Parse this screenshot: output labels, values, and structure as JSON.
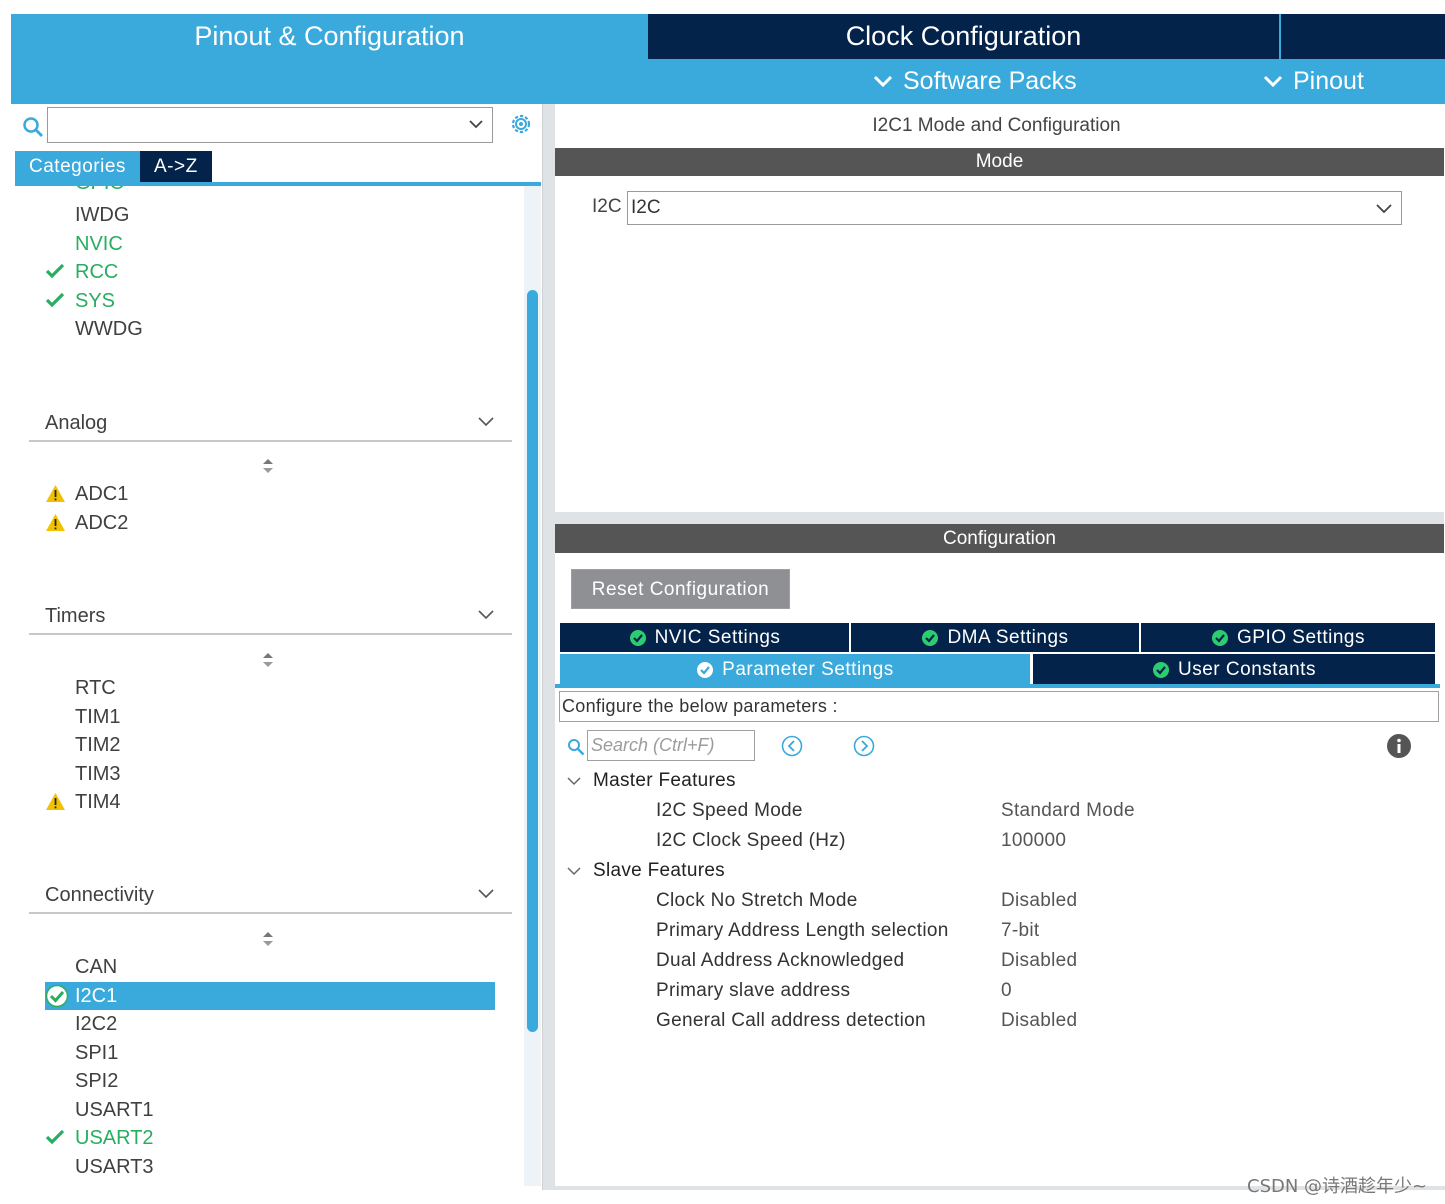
{
  "header": {
    "tab_pinout": "Pinout & Configuration",
    "tab_clock": "Clock Configuration",
    "subtab_software_packs": "Software Packs",
    "subtab_pinout": "Pinout"
  },
  "left": {
    "search_value": "",
    "category_tabs": [
      "Categories",
      "A->Z"
    ],
    "partial_item": "GPIO",
    "system_items": [
      {
        "label": "IWDG",
        "status": "none"
      },
      {
        "label": "NVIC",
        "status": "green"
      },
      {
        "label": "RCC",
        "status": "check"
      },
      {
        "label": "SYS",
        "status": "check"
      },
      {
        "label": "WWDG",
        "status": "none"
      }
    ],
    "groups": {
      "analog": {
        "title": "Analog",
        "items": [
          {
            "label": "ADC1",
            "status": "warning"
          },
          {
            "label": "ADC2",
            "status": "warning"
          }
        ]
      },
      "timers": {
        "title": "Timers",
        "items": [
          {
            "label": "RTC",
            "status": "none"
          },
          {
            "label": "TIM1",
            "status": "none"
          },
          {
            "label": "TIM2",
            "status": "none"
          },
          {
            "label": "TIM3",
            "status": "none"
          },
          {
            "label": "TIM4",
            "status": "warning"
          }
        ]
      },
      "connectivity": {
        "title": "Connectivity",
        "items": [
          {
            "label": "CAN",
            "status": "none"
          },
          {
            "label": "I2C1",
            "status": "selected"
          },
          {
            "label": "I2C2",
            "status": "none"
          },
          {
            "label": "SPI1",
            "status": "none"
          },
          {
            "label": "SPI2",
            "status": "none"
          },
          {
            "label": "USART1",
            "status": "none"
          },
          {
            "label": "USART2",
            "status": "check"
          },
          {
            "label": "USART3",
            "status": "none"
          }
        ]
      }
    }
  },
  "right": {
    "title": "I2C1 Mode and Configuration",
    "mode_bar": "Mode",
    "mode_label": "I2C",
    "mode_value": "I2C",
    "configuration_bar": "Configuration",
    "reset_button": "Reset Configuration",
    "tabs_row1": [
      "NVIC Settings",
      "DMA Settings",
      "GPIO Settings"
    ],
    "tabs_row2": [
      "Parameter Settings",
      "User Constants"
    ],
    "active_tab": "Parameter Settings",
    "param_description": "Configure the below parameters :",
    "search_placeholder": "Search (Ctrl+F)",
    "groups": [
      {
        "title": "Master Features",
        "params": [
          {
            "name": "I2C Speed Mode",
            "value": "Standard Mode"
          },
          {
            "name": "I2C Clock Speed (Hz)",
            "value": "100000"
          }
        ]
      },
      {
        "title": "Slave Features",
        "params": [
          {
            "name": "Clock No Stretch Mode",
            "value": "Disabled"
          },
          {
            "name": "Primary Address Length selection",
            "value": "7-bit"
          },
          {
            "name": "Dual Address Acknowledged",
            "value": "Disabled"
          },
          {
            "name": "Primary slave address",
            "value": "0"
          },
          {
            "name": "General Call address detection",
            "value": "Disabled"
          }
        ]
      }
    ]
  },
  "watermark": "CSDN @诗酒趁年少~",
  "colors": {
    "accent": "#3aa9dc",
    "navy": "#03234b",
    "green": "#27ae60",
    "warning": "#f2c200",
    "bar_gray": "#555555"
  }
}
